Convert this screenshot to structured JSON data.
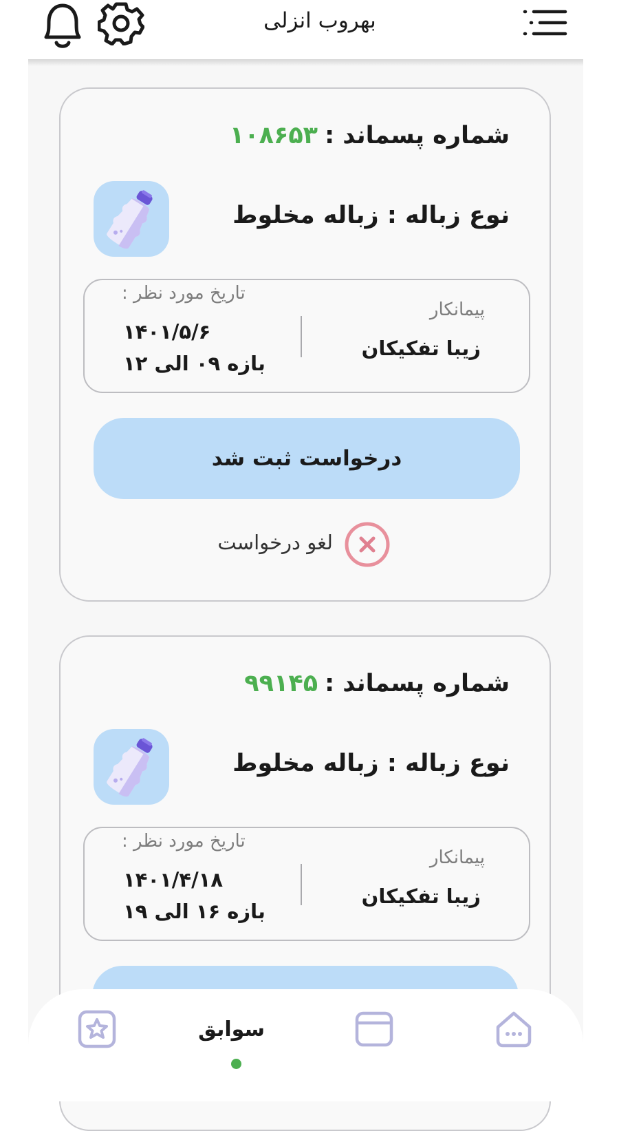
{
  "header": {
    "title": "بهروب انزلی",
    "icons": [
      "notification-bell-icon",
      "settings-gear-icon",
      "hamburger-menu-icon"
    ]
  },
  "cards": [
    {
      "number_label": "شماره پسماند :",
      "number_value": "۱۰۸۶۵۳",
      "type_label": "نوع زباله :",
      "type_value": "زباله مخلوط",
      "contractor_label": "پیمانکار",
      "contractor_name": "زیبا تفکیکان",
      "date_label": "تاریخ مورد نظر :",
      "date_value": "۱۴۰۱/۵/۶",
      "range_value": "بازه ۰۹ الی ۱۲",
      "status_label": "درخواست ثبت شد",
      "cancel_label": "لغو درخواست"
    },
    {
      "number_label": "شماره پسماند :",
      "number_value": "۹۹۱۴۵",
      "type_label": "نوع زباله :",
      "type_value": "زباله مخلوط",
      "contractor_label": "پیمانکار",
      "contractor_name": "زیبا تفکیکان",
      "date_label": "تاریخ مورد نظر :",
      "date_value": "۱۴۰۱/۴/۱۸",
      "range_value": "بازه ۱۶ الی ۱۹"
    }
  ],
  "bottom_nav": {
    "active_label": "سوابق",
    "items": [
      "favorites-star-icon",
      "history-active-tab",
      "wallet-card-icon",
      "home-icon"
    ]
  },
  "colors": {
    "accent_green": "#4caf50",
    "light_blue": "#bcdcf8",
    "cancel_pink": "#e8909c",
    "icon_lavender": "#b4b4dc"
  }
}
